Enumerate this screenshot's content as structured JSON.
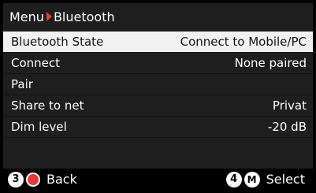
{
  "header": {
    "root": "Menu",
    "current": "Bluetooth",
    "separator_icon": "red-triangle-right"
  },
  "menu": {
    "items": [
      {
        "label": "Bluetooth State",
        "value": "Connect to Mobile/PC",
        "selected": true
      },
      {
        "label": "Connect",
        "value": "None paired"
      },
      {
        "label": "Pair",
        "value": ""
      },
      {
        "label": "Share to net",
        "value": "Privat"
      },
      {
        "label": "Dim level",
        "value": "-20 dB"
      }
    ]
  },
  "footer": {
    "back_key_number": "3",
    "back_icon": "red-circle",
    "back_label": "Back",
    "select_key_number": "4",
    "select_key_letter": "M",
    "select_label": "Select"
  },
  "colors": {
    "accent_red": "#e03a3a",
    "selected_row_bg": "#f2f2f2",
    "panel_bg": "#1e1e1e"
  }
}
